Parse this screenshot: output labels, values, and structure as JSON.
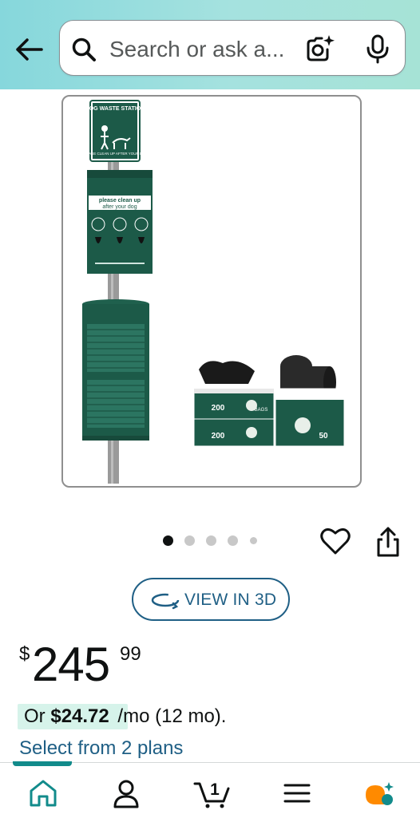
{
  "header": {
    "search": {
      "placeholder": "Search or ask a..."
    },
    "icons": {
      "back": "arrow-left-icon",
      "search": "search-icon",
      "camera": "camera-lens-icon",
      "mic": "microphone-icon"
    }
  },
  "product": {
    "image": {
      "sign_title": "DOG WASTE STATION",
      "sign_subtitle": "PLEASE CLEAN UP AFTER YOUR DOG",
      "dispenser_text_1": "please clean up",
      "dispenser_text_2": "after your dog",
      "box_label_1": "200",
      "box_label_2": "200",
      "box_label_3": "50",
      "box_brand": "BAGS"
    },
    "carousel": {
      "total": 5,
      "active": 0
    },
    "view3d_label": "VIEW IN 3D",
    "price": {
      "symbol": "$",
      "whole": "245",
      "fraction": "99"
    },
    "installment": {
      "prefix": "Or",
      "amount": "$24.72",
      "suffix": "/mo (12 mo)."
    },
    "select_plans": "Select from 2 plans"
  },
  "bottom_nav": {
    "items": [
      {
        "name": "home",
        "icon": "home-icon"
      },
      {
        "name": "account",
        "icon": "person-icon"
      },
      {
        "name": "cart",
        "icon": "cart-icon",
        "count": "1"
      },
      {
        "name": "menu",
        "icon": "menu-icon"
      },
      {
        "name": "rufus",
        "icon": "ai-assistant-icon"
      }
    ]
  },
  "colors": {
    "header_start": "#86d7dc",
    "header_end": "#a6e3d6",
    "link": "#1f5f85",
    "nav_accent": "#128b8b",
    "rufus_orange": "#ff8a00",
    "product_green": "#1c5a48"
  }
}
